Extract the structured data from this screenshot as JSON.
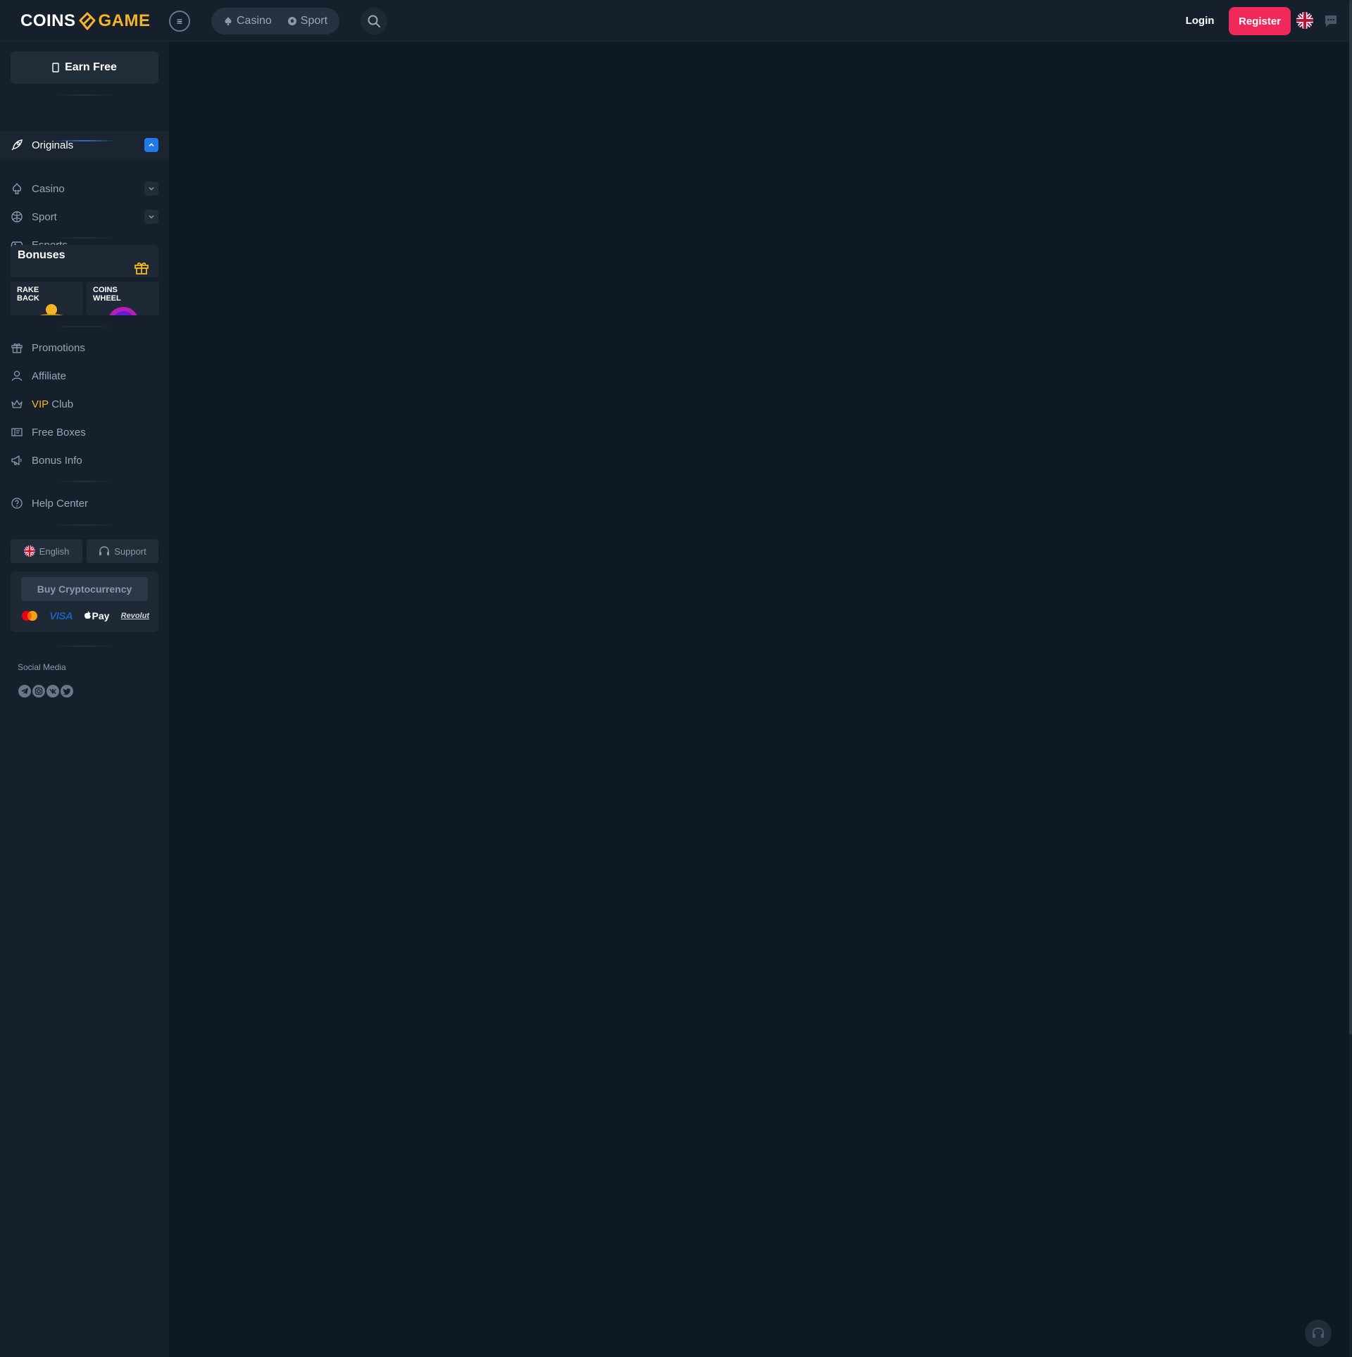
{
  "brand": {
    "part1": "COINS",
    "part2": "GAME"
  },
  "header": {
    "menu_icon": "menu-icon",
    "tabs": [
      {
        "label": "Casino",
        "icon": "spade-icon"
      },
      {
        "label": "Sport",
        "icon": "soccer-ball-icon"
      }
    ],
    "search_icon": "search-icon",
    "login": "Login",
    "register": "Register",
    "language_icon": "uk-flag-icon",
    "chat_icon": "chat-icon"
  },
  "sidebar": {
    "earn_free": "Earn Free",
    "nav_top": [
      {
        "label": "Originals",
        "icon": "rocket-icon",
        "expandable": true,
        "expanded": true
      },
      {
        "label": "Casino",
        "icon": "spade-icon",
        "expandable": true,
        "expanded": false
      },
      {
        "label": "Sport",
        "icon": "basketball-icon",
        "expandable": true,
        "expanded": false
      },
      {
        "label": "Esports",
        "icon": "gamepad-icon",
        "expandable": false
      }
    ],
    "bonuses": {
      "title": "Bonuses",
      "tiles": [
        {
          "line1": "RAKE",
          "line2": "BACK"
        },
        {
          "line1": "COINS",
          "line2": "WHEEL"
        }
      ]
    },
    "nav_mid": [
      {
        "label": "Promotions",
        "icon": "gift-icon"
      },
      {
        "label": "Affiliate",
        "icon": "users-icon"
      },
      {
        "label_highlight": "VIP",
        "label": "Club",
        "icon": "crown-icon"
      },
      {
        "label": "Free Boxes",
        "icon": "ticket-icon"
      },
      {
        "label": "Bonus Info",
        "icon": "megaphone-icon"
      }
    ],
    "help_center": "Help Center",
    "language": "English",
    "support": "Support",
    "buy_crypto": "Buy Cryptocurrency",
    "payments": {
      "visa": "VISA",
      "apple_pay": "Pay",
      "revolut": "Revolut"
    },
    "social_label": "Social Media",
    "social_icons": [
      "telegram-icon",
      "instagram-icon",
      "vk-icon",
      "twitter-icon"
    ]
  },
  "colors": {
    "background": "#0f1923",
    "panel": "#16202c",
    "accent_blue": "#1f7ae6",
    "register_red": "#f1295a",
    "brand_gold": "#f5b427"
  }
}
